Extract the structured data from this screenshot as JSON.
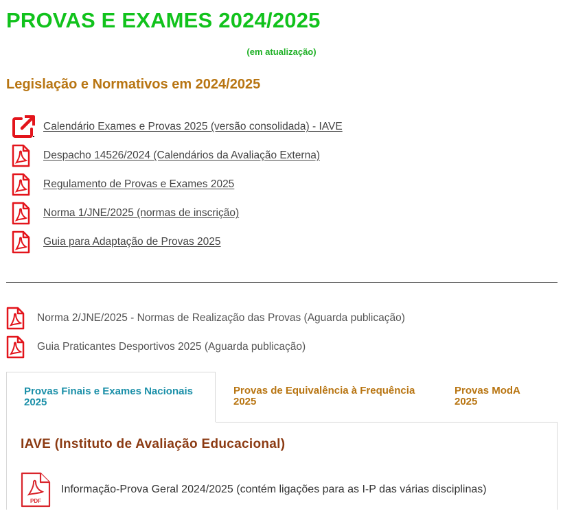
{
  "header": {
    "title": "PROVAS E EXAMES 2024/2025",
    "subtitle": "(em atualização)"
  },
  "legislation": {
    "title": "Legislação e Normativos em 2024/2025",
    "links": [
      {
        "label": "Calendário Exames e Provas 2025 (versão consolidada) - IAVE",
        "icon": "external-link-icon"
      },
      {
        "label": "Despacho 14526/2024 (Calendários da Avaliação Externa)",
        "icon": "pdf-icon"
      },
      {
        "label": "Regulamento de Provas e Exames 2025",
        "icon": "pdf-icon"
      },
      {
        "label": "Norma 1/JNE/2025 (normas de inscrição)",
        "icon": "pdf-icon"
      },
      {
        "label": "Guia para Adaptação de Provas 2025",
        "icon": "pdf-icon"
      }
    ]
  },
  "pending": {
    "items": [
      {
        "label": "Norma 2/JNE/2025 - Normas de Realização das Provas (Aguarda publicação)",
        "icon": "pdf-icon"
      },
      {
        "label": "Guia Praticantes Desportivos 2025 (Aguarda publicação)",
        "icon": "pdf-icon"
      }
    ]
  },
  "tabs": [
    {
      "line1": "Provas Finais e Exames Nacionais",
      "line2": "2025",
      "active": true
    },
    {
      "line1": "Provas de Equivalência à Frequência",
      "line2": "2025",
      "active": false
    },
    {
      "line1": "Provas ModA",
      "line2": "2025",
      "active": false
    }
  ],
  "panel": {
    "title": "IAVE (Instituto de Avaliação Educacional)",
    "doc": {
      "label": "Informação-Prova Geral 2024/2025 (contém ligações para as I-P das várias disciplinas)",
      "icon_text": "PDF"
    }
  },
  "colors": {
    "title_green": "#11c21c",
    "section_orange": "#b87512",
    "active_tab_teal": "#1a8fa8",
    "panel_title_brown": "#8b3a12",
    "icon_red": "#e3141b"
  }
}
